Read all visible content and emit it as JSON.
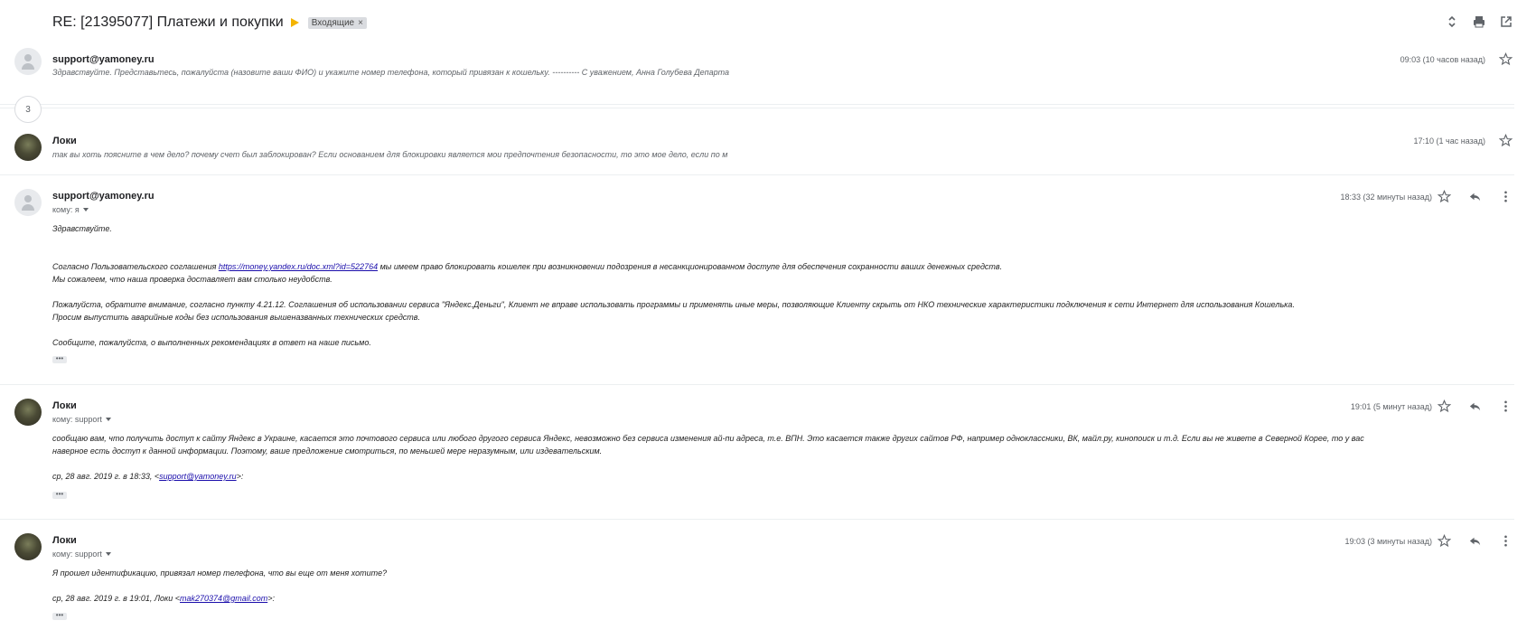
{
  "thread": {
    "subject": "RE: [21395077] Платежи и покупки",
    "label": "Входящие",
    "label_close": "×"
  },
  "collapsed_count": "3",
  "messages": [
    {
      "sender": "support@yamoney.ru",
      "time": "09:03 (10 часов назад)",
      "snippet": "Здравствуйте. Представьтесь, пожалуйста (назовите ваши ФИО) и укажите номер телефона, который привязан к кошельку. ---------- С уважением, Анна Голубева Департа"
    },
    {
      "sender": "Локи",
      "time": "17:10 (1 час назад)",
      "snippet": "так вы хоть поясните в чем дело? почему счет был заблокирован? Если основанием для блокировки является мои предпочтения безопасности, то это мое дело, если по м"
    },
    {
      "sender": "support@yamoney.ru",
      "time": "18:33 (32 минуты назад)",
      "to": "кому: я",
      "lines": [
        "Здравствуйте.",
        "Согласно Пользовательского соглашения ",
        "https://money.yandex.ru/doc.xml?id=522764",
        " мы имеем право блокировать кошелек при возникновении подозрения в несанкционированном доступе для обеспечения сохранности ваших денежных средств.",
        "Мы сожалеем, что наша проверка доставляет вам столько неудобств.",
        "Пожалуйста, обратите внимание, согласно пункту 4.21.12. Соглашения об использовании сервиса \"Яндекс.Деньги\", Клиент не вправе использовать программы и применять иные меры, позволяющие Клиенту скрыть от НКО технические характеристики подключения к сети Интернет для использования Кошелька.",
        "Просим выпустить аварийные коды без использования вышеназванных технических средств.",
        "Сообщите, пожалуйста, о выполненных рекомендациях в ответ на наше письмо."
      ]
    },
    {
      "sender": "Локи",
      "time": "19:01 (5 минут назад)",
      "to": "кому: support",
      "lines": [
        "сообщаю вам, что получить доступ к сайту Яндекс в Украине, касается это почтового сервиса или любого другого сервиса Яндекс, невозможно без сервиса изменения ай-пи адреса, т.е. ВПН. Это касается также других сайтов РФ, например одноклассники, ВК, майл.ру, кинопоиск и т.д. Если вы не живете в Северной Корее, то у вас",
        "наверное есть доступ к данной информации. Поэтому, ваше предложение смотриться, по меньшей мере неразумным, или издевательским.",
        "ср, 28 авг. 2019 г. в 18:33, <",
        "support@yamoney.ru",
        ">:"
      ]
    },
    {
      "sender": "Локи",
      "time": "19:03 (3 минуты назад)",
      "to": "кому: support",
      "lines": [
        "Я прошел идентификацию, привязал номер телефона, что вы еще от меня хотите?",
        "ср, 28 авг. 2019 г. в 19:01, Локи <",
        "mak270374@gmail.com",
        ">:"
      ]
    }
  ],
  "icons": [
    "expand-collapse-icon",
    "print-icon",
    "open-in-new-window-icon",
    "star-icon",
    "reply-icon",
    "more-vert-icon",
    "caret-down-icon",
    "ellipsis-icon"
  ],
  "colors": {
    "important_marker": "#f4b400",
    "link": "#1a0dab",
    "label_bg": "#dadce0"
  }
}
